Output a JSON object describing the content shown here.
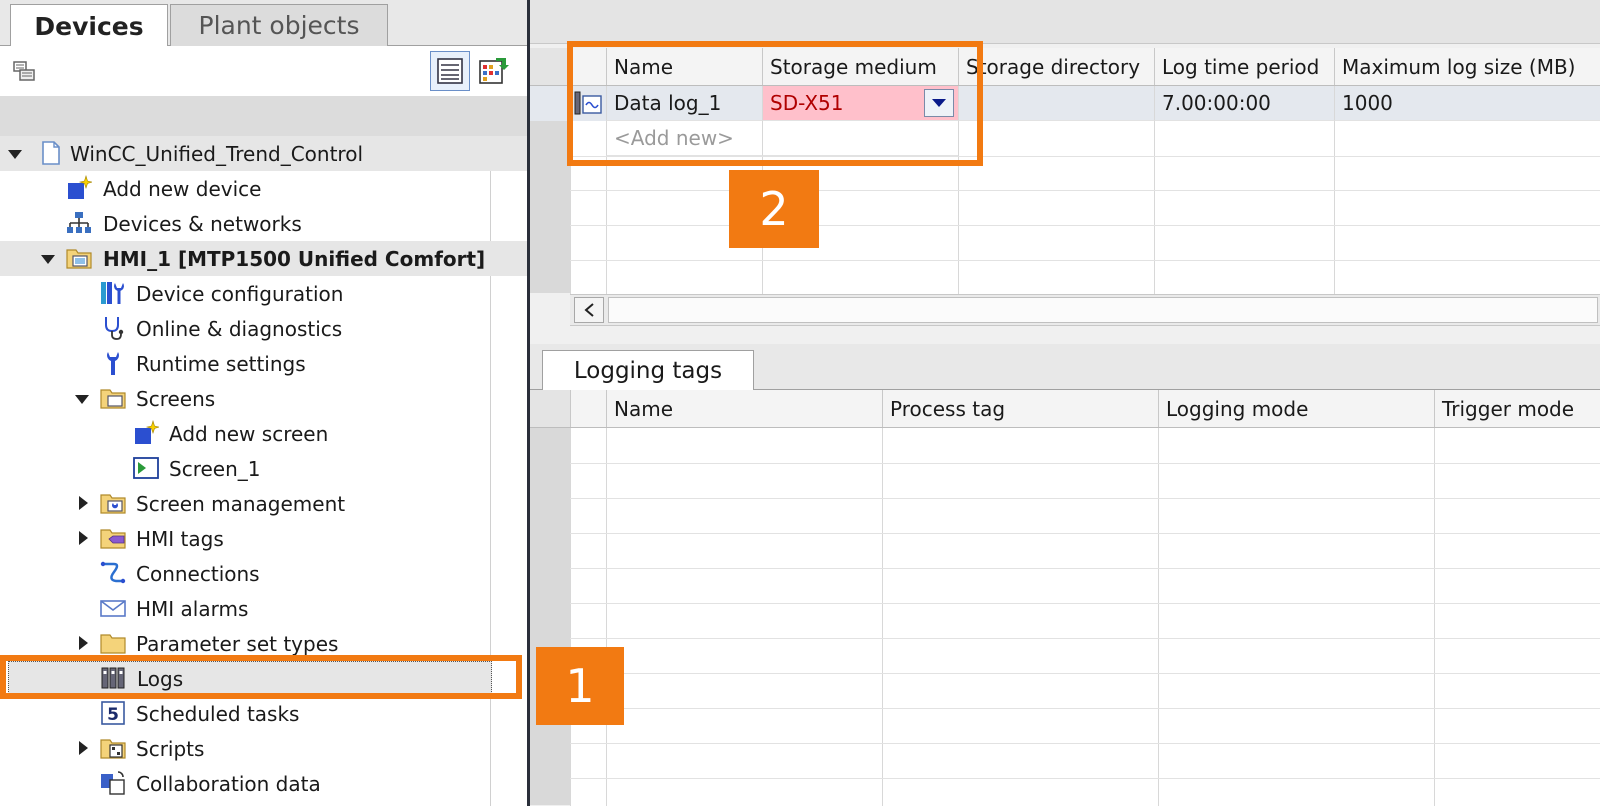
{
  "project_tree": {
    "tabs": [
      {
        "label": "Devices"
      },
      {
        "label": "Plant objects"
      }
    ],
    "items": [
      {
        "label": "WinCC_Unified_Trend_Control",
        "icon": "document-icon",
        "expanded": true
      },
      {
        "label": "Add new device",
        "icon": "add-device-icon"
      },
      {
        "label": "Devices & networks",
        "icon": "network-icon"
      },
      {
        "label": "HMI_1 [MTP1500 Unified Comfort]",
        "icon": "hmi-folder-icon",
        "expanded": true
      },
      {
        "label": "Device configuration",
        "icon": "device-config-icon"
      },
      {
        "label": "Online & diagnostics",
        "icon": "diagnostics-icon"
      },
      {
        "label": "Runtime settings",
        "icon": "wrench-icon"
      },
      {
        "label": "Screens",
        "icon": "folder-icon",
        "expanded": true
      },
      {
        "label": "Add new screen",
        "icon": "add-screen-icon"
      },
      {
        "label": "Screen_1",
        "icon": "screen-icon"
      },
      {
        "label": "Screen management",
        "icon": "folder-icon",
        "expanded": false
      },
      {
        "label": "HMI tags",
        "icon": "folder-icon",
        "expanded": false
      },
      {
        "label": "Connections",
        "icon": "connections-icon"
      },
      {
        "label": "HMI alarms",
        "icon": "envelope-icon"
      },
      {
        "label": "Parameter set types",
        "icon": "folder-icon",
        "expanded": false
      },
      {
        "label": "Logs",
        "icon": "logs-icon",
        "selected": true
      },
      {
        "label": "Scheduled tasks",
        "icon": "scheduled-task-icon"
      },
      {
        "label": "Scripts",
        "icon": "folder-icon",
        "expanded": false
      },
      {
        "label": "Collaboration data",
        "icon": "collaboration-icon"
      }
    ]
  },
  "logs_table": {
    "columns": [
      "Name",
      "Storage medium",
      "Storage directory",
      "Log time period",
      "Maximum log size (MB)"
    ],
    "rows": [
      {
        "name": "Data log_1",
        "storage_medium": "SD-X51",
        "storage_directory": "",
        "log_time_period": "7.00:00:00",
        "max_log_size": "1000"
      }
    ],
    "add_new": "<Add new>"
  },
  "logging_tags": {
    "tab_label": "Logging tags",
    "columns": [
      "Name",
      "Process tag",
      "Logging mode",
      "Trigger mode"
    ]
  },
  "callouts": {
    "one": "1",
    "two": "2"
  },
  "colors": {
    "accent": "#f27a12",
    "highlight_cell": "#ffc0cb",
    "selection": "#e6e6e6"
  }
}
